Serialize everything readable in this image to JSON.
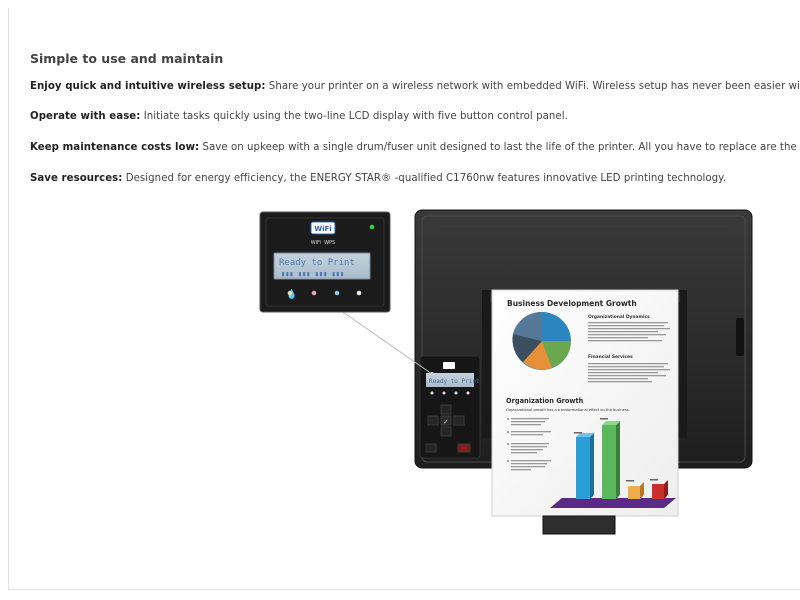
{
  "section": {
    "title": "Simple to use and maintain",
    "features": [
      {
        "label": "Enjoy quick and intuitive wireless setup:",
        "text": "Share your printer on a wireless network with embedded WiFi. Wireless setup has never been easier with"
      },
      {
        "label": "Operate with ease:",
        "text": "Initiate tasks quickly using the two-line LCD display with five button control panel."
      },
      {
        "label": "Keep maintenance costs low:",
        "text": "Save on upkeep with a single drum/fuser unit designed to last the life of the printer. All you have to replace are the to"
      },
      {
        "label": "Save resources:",
        "text": "Designed for energy efficiency, the ENERGY STAR® -qualified C1760nw features innovative LED printing technology."
      }
    ]
  },
  "printer_panel": {
    "wifi_label": "WiFi",
    "wifi_wps_label": "WiFi   WPS",
    "lcd_text": "Ready to Print",
    "led_color": "#37d237"
  },
  "printed_page": {
    "title": "Business Development Growth",
    "subheading_1": "Organizational Dynamics",
    "subheading_2": "Financial Services",
    "section_title": "Organization Growth",
    "section_intro": "Organizational growth has a transformational effect on the business.",
    "pie_colors": [
      "#2e86c1",
      "#6aa84f",
      "#e69138",
      "#4a5a6a"
    ],
    "bar_colors": [
      "#2a9fd6",
      "#5cb85c",
      "#f0ad4e",
      "#c9302c"
    ]
  },
  "colors": {
    "heading": "#444444",
    "printer_body": "#2a2a2a"
  }
}
